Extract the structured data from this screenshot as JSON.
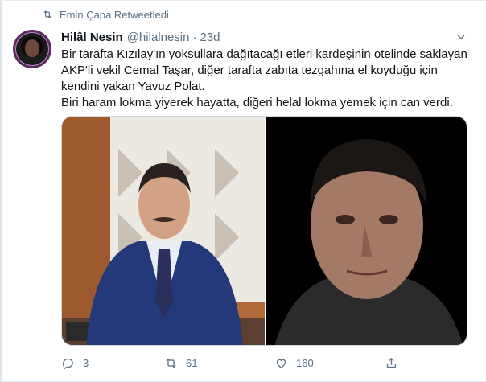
{
  "retweet": {
    "label": "Emin Çapa Retweetledi"
  },
  "tweet": {
    "name": "Hilâl Nesin",
    "handle": "@hilalnesin",
    "separator": "·",
    "time": "23d",
    "lines": [
      "Bir tarafta Kızılay'ın yoksullara dağıtacağı etleri kardeşinin otelinde saklayan",
      "AKP'li vekil Cemal Taşar, diğer tarafta zabıta tezgahına el koyduğu için",
      "kendini yakan Yavuz Polat.",
      "Biri haram lokma yiyerek hayatta, diğeri helal lokma yemek için can verdi."
    ]
  },
  "actions": {
    "reply_count": "3",
    "retweet_count": "61",
    "like_count": "160"
  },
  "colors": {
    "text": "#0f1419",
    "secondary": "#5b7083",
    "border": "#cfd9de"
  }
}
